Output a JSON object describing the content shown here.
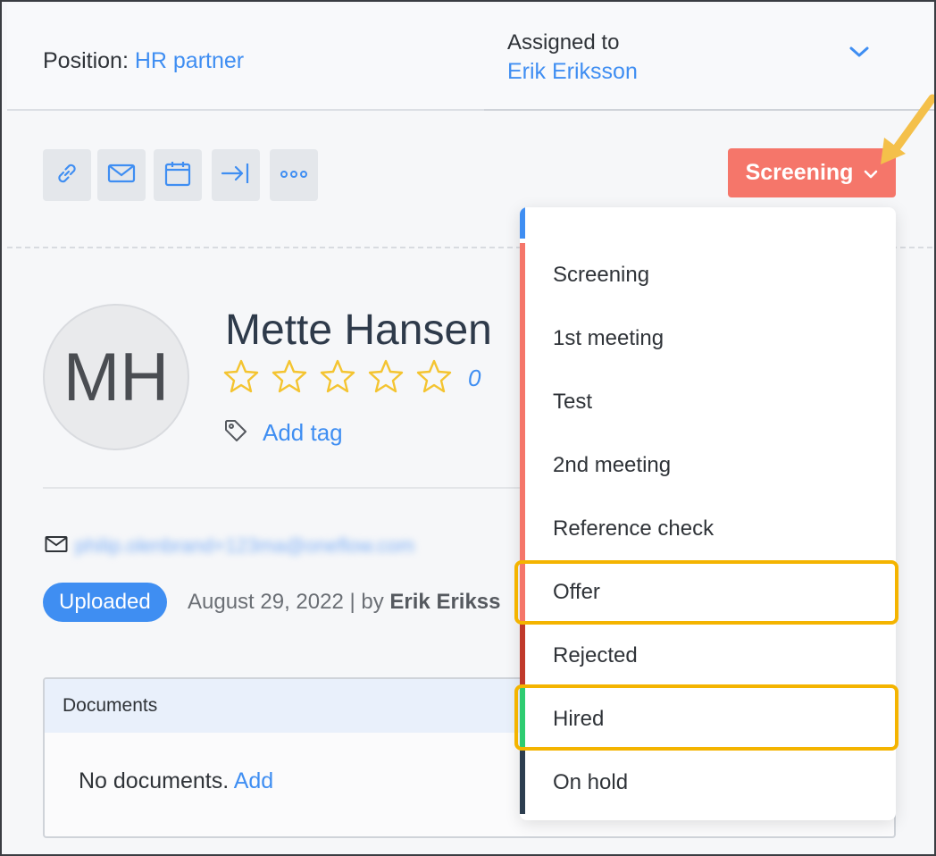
{
  "header": {
    "position_label": "Position:",
    "position_value": "HR partner",
    "assigned_label": "Assigned to",
    "assigned_value": "Erik Eriksson"
  },
  "toolbar": {
    "icons": [
      "link-icon",
      "mail-icon",
      "calendar-icon",
      "move-icon",
      "more-icon"
    ],
    "stage_label": "Screening"
  },
  "candidate": {
    "initials": "MH",
    "name": "Mette Hansen",
    "rating": "0",
    "stars_filled": 0,
    "stars_total": 5,
    "add_tag": "Add tag",
    "email": "philip.olenbrand+123ma@oneflow.com",
    "badge": "Uploaded",
    "upload_date": "August 29, 2022 | by ",
    "upload_by": "Erik Erikss"
  },
  "documents": {
    "title": "Documents",
    "empty_text": "No documents.",
    "add_label": "Add"
  },
  "stages": [
    {
      "label": "",
      "color": "#3f8ef2"
    },
    {
      "label": "Screening",
      "color": "#f5766a"
    },
    {
      "label": "1st meeting",
      "color": "#f5766a"
    },
    {
      "label": "Test",
      "color": "#f5766a"
    },
    {
      "label": "2nd meeting",
      "color": "#f5766a"
    },
    {
      "label": "Reference check",
      "color": "#f5766a"
    },
    {
      "label": "Offer",
      "color": "#f5766a"
    },
    {
      "label": "Rejected",
      "color": "#c0392b"
    },
    {
      "label": "Hired",
      "color": "#2ecc71"
    },
    {
      "label": "On hold",
      "color": "#2d3e50"
    }
  ],
  "colors": {
    "accent": "#3f8ef2",
    "stage_button": "#f5766a",
    "highlight": "#f4b400"
  }
}
